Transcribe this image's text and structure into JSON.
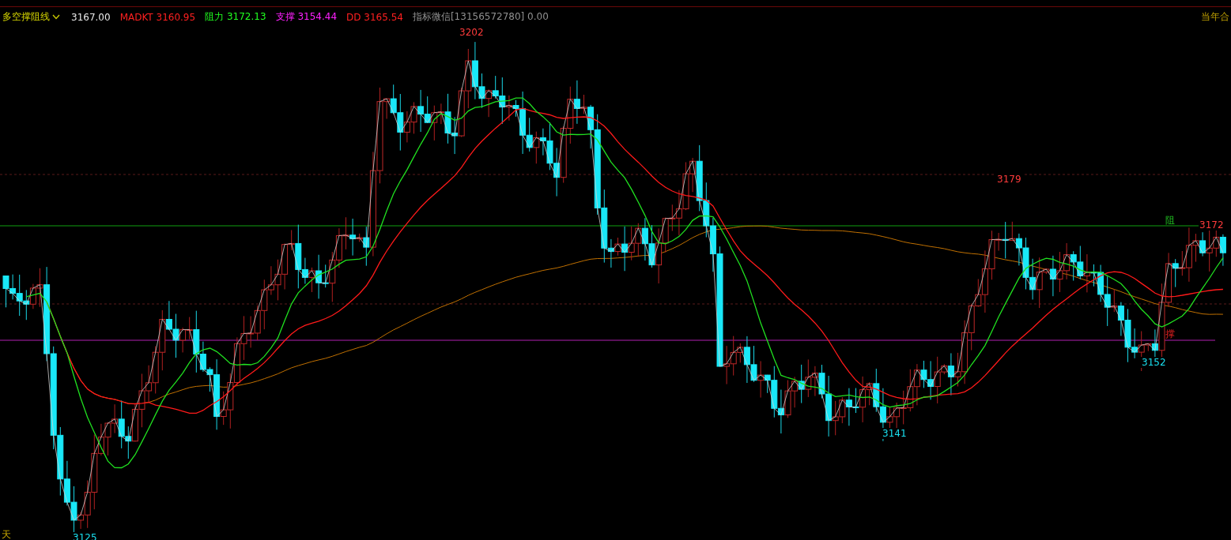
{
  "legend": {
    "indicator_name": "多空撑阻线",
    "price": "3167.00",
    "fields": [
      {
        "label": "MADKT",
        "value": "3160.95",
        "color": "#ff2020"
      },
      {
        "label": "阻力",
        "value": "3172.13",
        "color": "#20ff20"
      },
      {
        "label": "支撑",
        "value": "3154.44",
        "color": "#ff20ff"
      },
      {
        "label": "DD",
        "value": "3165.54",
        "color": "#ff2020"
      }
    ],
    "contact": "指标微信[13156572780] 0.00",
    "contract_note": "当年合"
  },
  "price_labels": [
    {
      "text": "3202",
      "kind": "high"
    },
    {
      "text": "3179",
      "kind": "high"
    },
    {
      "text": "3172",
      "kind": "high"
    },
    {
      "text": "3152",
      "kind": "low"
    },
    {
      "text": "3141",
      "kind": "low"
    },
    {
      "text": "3125",
      "kind": "low"
    }
  ],
  "level_markers": [
    {
      "text": "阻",
      "kind": "resistance"
    },
    {
      "text": "撑",
      "kind": "support"
    }
  ],
  "period_note": "天"
}
